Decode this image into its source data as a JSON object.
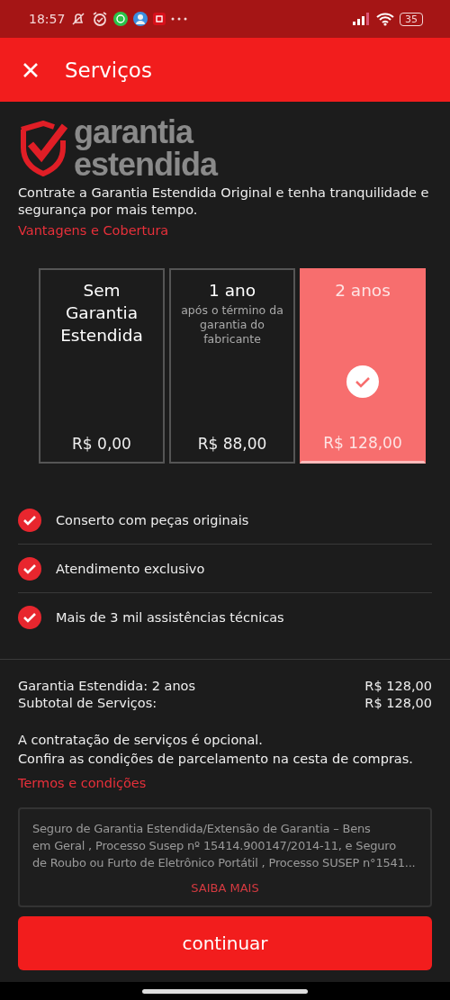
{
  "status_bar": {
    "time": "18:57",
    "battery": "35"
  },
  "header": {
    "title": "Serviços"
  },
  "logo": {
    "line_1": "garantia",
    "line_2": "estendida"
  },
  "intro": {
    "text": "Contrate a Garantia Estendida Original e tenha tranquilidade e segurança por mais tempo.",
    "link": "Vantagens e Cobertura"
  },
  "plans": [
    {
      "title": "Sem Garantia Estendida",
      "price": "R$  0,00",
      "selected": false
    },
    {
      "title": "1 ano",
      "subtitle": "após o término da garantia do fabricante",
      "price": "R$  88,00",
      "selected": false
    },
    {
      "title": "2 anos",
      "price": "R$  128,00",
      "selected": true
    }
  ],
  "benefits": [
    "Conserto com peças originais",
    "Atendimento exclusivo",
    "Mais de 3 mil assistências técnicas"
  ],
  "summary": [
    {
      "label": "Garantia Estendida: 2 anos",
      "value": "R$  128,00"
    },
    {
      "label": "Subtotal de Serviços:",
      "value": "R$  128,00"
    }
  ],
  "notes": [
    "A contratação de serviços é opcional.",
    "Confira as condições de parcelamento na cesta de compras."
  ],
  "terms_link": "Termos e condições",
  "legal": {
    "lines": [
      "Seguro de Garantia Estendida/Extensão de Garantia – Bens",
      "em Geral , Processo Susep nº 15414.900147/2014-11, e Seguro",
      "de Roubo ou Furto de Eletrônico Portátil , Processo SUSEP n°1541..."
    ],
    "more": "SAIBA MAIS"
  },
  "continue_button": "continuar"
}
